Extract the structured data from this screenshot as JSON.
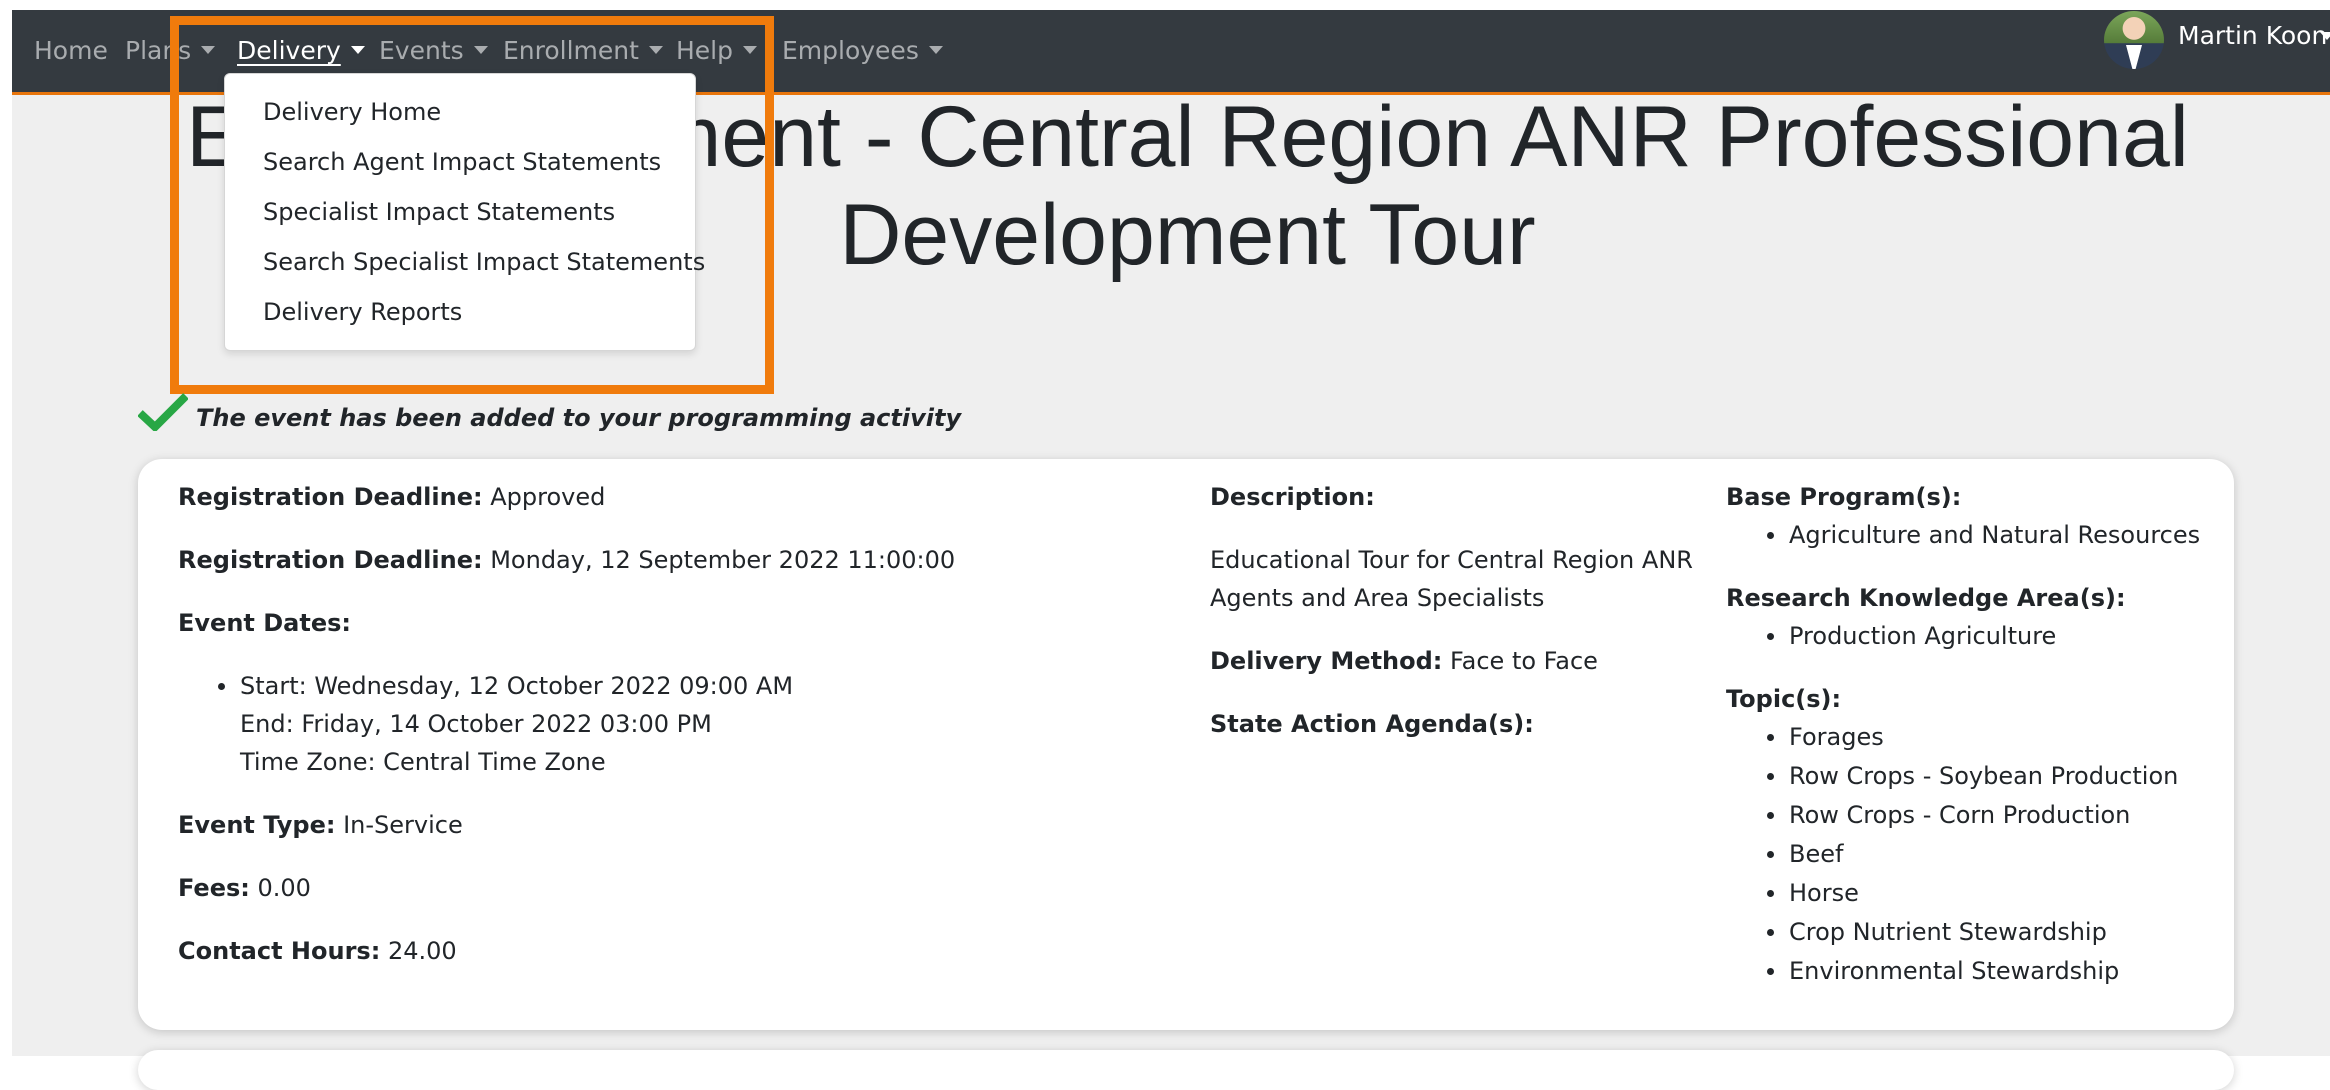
{
  "navbar": {
    "items": [
      {
        "label": "Home"
      },
      {
        "label": "Plans"
      },
      {
        "label": "Delivery"
      },
      {
        "label": "Events"
      },
      {
        "label": "Enrollment"
      },
      {
        "label": "Help"
      },
      {
        "label": "Employees"
      }
    ],
    "user_name": "Martin Koon"
  },
  "page": {
    "title": "Event Enrollment - Central Region ANR Professional Development Tour"
  },
  "dropdown": {
    "items": [
      "Delivery Home",
      "Search Agent Impact Statements",
      "Specialist Impact Statements",
      "Search Specialist Impact Statements",
      "Delivery Reports"
    ]
  },
  "success": {
    "message": "The event has been added to your programming activity"
  },
  "event": {
    "status_label": "Registration Deadline:",
    "status_value": "Approved",
    "deadline_label": "Registration Deadline:",
    "deadline_value": "Monday, 12 September 2022 11:00:00",
    "dates_label": "Event Dates:",
    "start": "Start: Wednesday, 12 October 2022 09:00 AM",
    "end": "End: Friday, 14 October 2022 03:00 PM",
    "timezone": "Time Zone: Central Time Zone",
    "type_label": "Event Type:",
    "type_value": "In-Service",
    "fees_label": "Fees:",
    "fees_value": "0.00",
    "hours_label": "Contact Hours:",
    "hours_value": "24.00",
    "description_label": "Description:",
    "description_line1": "Educational Tour for Central Region ANR",
    "description_line2": "Agents and Area Specialists",
    "delivery_label": "Delivery Method:",
    "delivery_value": "Face to Face",
    "agenda_label": "State Action Agenda(s):",
    "base_program_label": "Base Program(s):",
    "base_programs": [
      "Agriculture and Natural Resources"
    ],
    "knowledge_area_label": "Research Knowledge Area(s):",
    "knowledge_areas": [
      "Production Agriculture"
    ],
    "topics_label": "Topic(s):",
    "topics": [
      "Forages",
      "Row Crops - Soybean Production",
      "Row Crops - Corn Production",
      "Beef",
      "Horse",
      "Crop Nutrient Stewardship",
      "Environmental Stewardship"
    ]
  },
  "colors": {
    "navbar_bg": "#343a40",
    "accent_orange": "#f07b0c",
    "success_green": "#28a745"
  }
}
